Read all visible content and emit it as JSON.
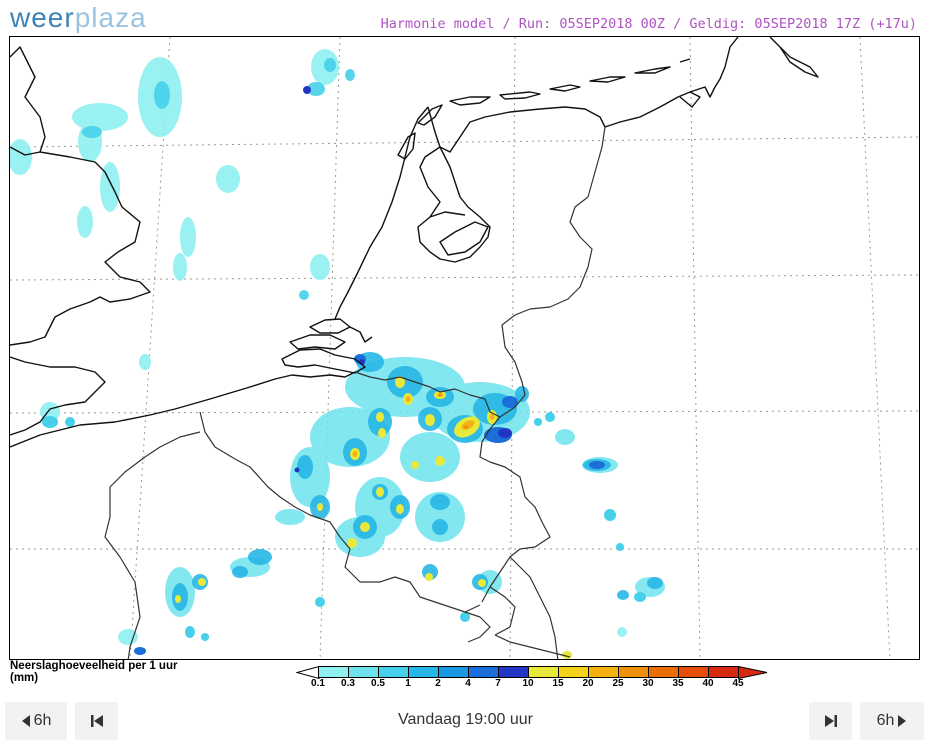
{
  "brand": {
    "logo_part1": "weer",
    "logo_part2": "plaza"
  },
  "header": {
    "run_info": "Harmonie model / Run: 05SEP2018 00Z / Geldig: 05SEP2018 17Z (+17u)"
  },
  "legend": {
    "title_line1": "Neerslaghoeveelheid per 1 uur",
    "title_line2": "(mm)",
    "labels": [
      "0.1",
      "0.3",
      "0.5",
      "1",
      "2",
      "4",
      "7",
      "10",
      "15",
      "20",
      "25",
      "30",
      "35",
      "40",
      "45"
    ],
    "colors": [
      "#8ff0f0",
      "#6ee3ee",
      "#46d0ea",
      "#27b7e6",
      "#1a98e2",
      "#1c6fd8",
      "#2137c4",
      "#e9e93a",
      "#f5d21c",
      "#f4b212",
      "#f09008",
      "#ec6e06",
      "#e44e08",
      "#d42a10"
    ]
  },
  "nav": {
    "back_label": "6h",
    "forward_label": "6h",
    "current_time": "Vandaag 19:00 uur"
  },
  "icons": {
    "back": "triangle-left-icon",
    "first": "skip-back-icon",
    "last": "skip-forward-icon",
    "forward": "triangle-right-icon"
  }
}
